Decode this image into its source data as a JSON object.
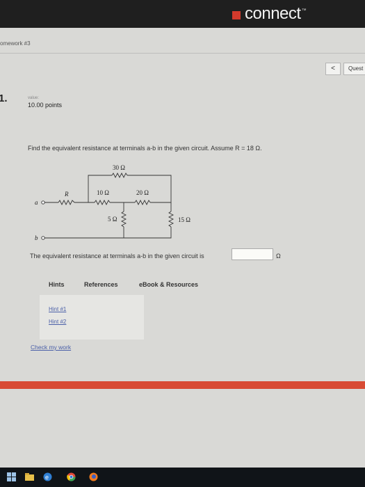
{
  "header": {
    "brand": "connect",
    "brand_mark": "™"
  },
  "assignment": {
    "title": "omework #3"
  },
  "nav": {
    "prev": "<",
    "question": "Quest"
  },
  "question": {
    "number": "1.",
    "value_label": "value:",
    "points": "10.00 points",
    "prompt": "Find the equivalent resistance at terminals a-b in the given circuit. Assume R = 18 Ω.",
    "answer_text": "The equivalent resistance at terminals a-b in the given circuit is",
    "answer_value": "",
    "answer_unit": "Ω"
  },
  "circuit": {
    "R": "R",
    "r30": "30 Ω",
    "r10": "10 Ω",
    "r20": "20 Ω",
    "r5": "5 Ω",
    "r15": "15 Ω",
    "terminal_a": "a",
    "terminal_b": "b"
  },
  "tabs": {
    "hints": "Hints",
    "references": "References",
    "ebook": "eBook & Resources"
  },
  "hints": {
    "hint1": "Hint #1",
    "hint2": "Hint #2"
  },
  "check": "Check my work",
  "colors": {
    "accent_red": "#d84b34",
    "link": "#4a5fa8",
    "topbar": "#1f1f1f"
  }
}
